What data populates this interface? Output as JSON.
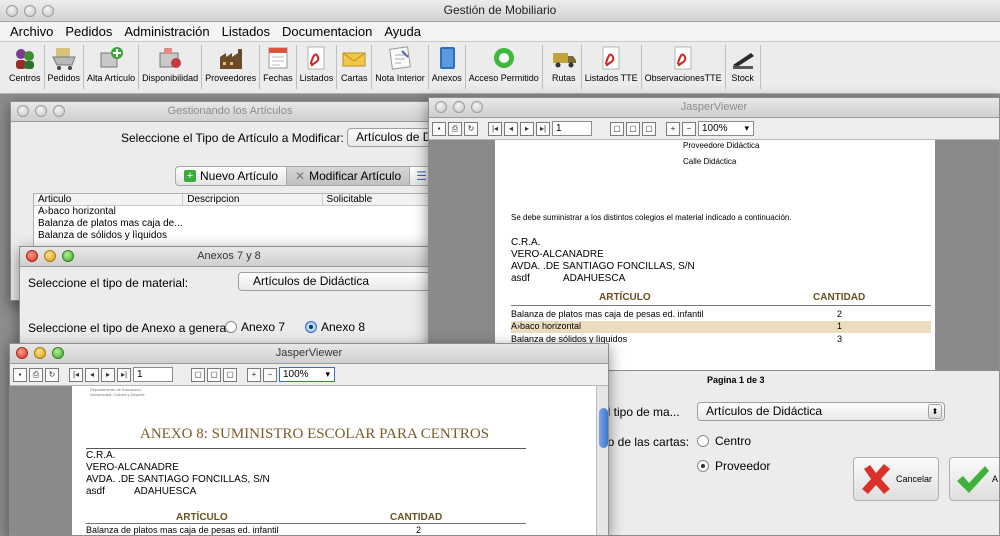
{
  "app": {
    "title": "Gestión de Mobiliario"
  },
  "menu": [
    "Archivo",
    "Pedidos",
    "Administración",
    "Listados",
    "Documentacion",
    "Ayuda"
  ],
  "toolbar": [
    {
      "label": "Centros",
      "icon": "users-icon"
    },
    {
      "label": "Pedidos",
      "icon": "cart-icon"
    },
    {
      "label": "Alta Artículo",
      "icon": "add-box-icon"
    },
    {
      "label": "Disponibilidad",
      "icon": "availability-icon"
    },
    {
      "label": "Proveedores",
      "icon": "factory-icon"
    },
    {
      "label": "Fechas",
      "icon": "calendar-icon"
    },
    {
      "label": "Listados",
      "icon": "pdf-icon"
    },
    {
      "label": "Cartas",
      "icon": "envelope-icon"
    },
    {
      "label": "Nota Interior",
      "icon": "note-icon"
    },
    {
      "label": "Anexos",
      "icon": "book-icon"
    },
    {
      "label": "Acceso Permitido",
      "icon": "access-icon"
    },
    {
      "label": "Rutas",
      "icon": "truck-icon"
    },
    {
      "label": "Listados TTE",
      "icon": "pdf-icon"
    },
    {
      "label": "ObservacionesTTE",
      "icon": "pdf-icon"
    },
    {
      "label": "Stock",
      "icon": "stapler-icon"
    }
  ],
  "articles_window": {
    "title": "Gestionando los Artículos",
    "prompt": "Seleccione el Tipo de Artículo a Modificar:",
    "type_value": "Artículos de Di",
    "tabs": [
      "Nuevo Artículo",
      "Modificar Artículo"
    ],
    "columns": [
      "Articulo",
      "Descripcion",
      "Solicitable"
    ],
    "rows": [
      "A›baco horizontal",
      "Balanza de platos  mas caja de...",
      "Balanza de sólidos y lìquidos"
    ]
  },
  "annexes_window": {
    "title": "Anexos 7 y 8",
    "material_label": "Seleccione el tipo de material:",
    "material_value": "Artículos de Didáctica",
    "annex_label": "Seleccione el tipo de Anexo a generar:",
    "options": [
      "Anexo 7",
      "Anexo 8"
    ],
    "selected": "Anexo 8"
  },
  "jasper_right": {
    "title": "JasperViewer",
    "page": "1",
    "zoom": "100%",
    "supplier_lines": [
      "Proveedore Didáctica",
      "Calle Didáctica"
    ],
    "intro": "Se debe suministrar a los distintos colegios el material indicado a continuación.",
    "address": [
      "C.R.A.",
      "VERO-ALCANADRE",
      "AVDA. .DE SANTIAGO FONCILLAS, S/N"
    ],
    "address_last": [
      "asdf",
      "ADAHUESCA"
    ],
    "col_article": "ARTÍCULO",
    "col_qty": "CANTIDAD",
    "items": [
      {
        "name": "Balanza de platos  mas caja de pesas ed. infantil",
        "qty": "2"
      },
      {
        "name": "A›baco horizontal",
        "qty": "1"
      },
      {
        "name": "Balanza de sólidos y lìquidos",
        "qty": "3"
      }
    ],
    "status": "Pagina 1 de 3"
  },
  "letters_window": {
    "type_label": "el tipo de ma...",
    "type_value": "Artículos de Didáctica",
    "recipient_label": "rio de las cartas:",
    "options": [
      "Centro",
      "Proveedor"
    ],
    "selected": "Proveedor",
    "cancel": "Cancelar",
    "accept": "A"
  },
  "jasper_left": {
    "title": "JasperViewer",
    "page": "1",
    "zoom": "100%",
    "header_small": [
      "Departamento de Educación,",
      "Universidad, Cultura y Deporte"
    ],
    "heading": "ANEXO 8: SUMINISTRO ESCOLAR PARA CENTROS",
    "address": [
      "C.R.A.",
      "VERO-ALCANADRE",
      "AVDA. .DE SANTIAGO FONCILLAS, S/N"
    ],
    "address_last": [
      "asdf",
      "ADAHUESCA"
    ],
    "col_article": "ARTÍCULO",
    "col_qty": "CANTIDAD",
    "items": [
      {
        "name": "Balanza de platos  mas caja de pesas ed. infantil",
        "qty": "2"
      }
    ]
  }
}
